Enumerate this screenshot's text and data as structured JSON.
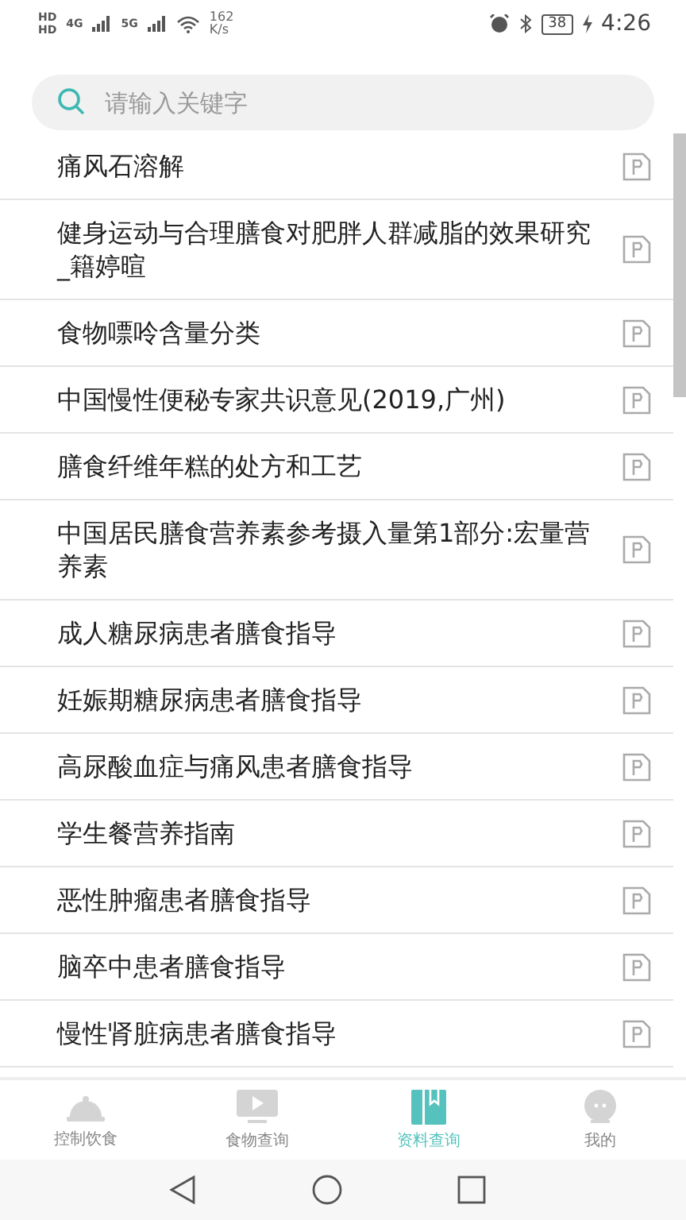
{
  "status_bar": {
    "sim_labels": [
      "HD",
      "HD"
    ],
    "networks": [
      "4G",
      "5G"
    ],
    "speed": [
      "162",
      "K/s"
    ],
    "battery": "38",
    "time": "4:26"
  },
  "search": {
    "placeholder": "请输入关键字"
  },
  "documents": [
    {
      "title": "痛风石溶解"
    },
    {
      "title": "健身运动与合理膳食对肥胖人群减脂的效果研究_籍婷暄"
    },
    {
      "title": "食物嘌呤含量分类"
    },
    {
      "title": "中国慢性便秘专家共识意见(2019,广州)"
    },
    {
      "title": "膳食纤维年糕的处方和工艺"
    },
    {
      "title": "中国居民膳食营养素参考摄入量第1部分:宏量营养素"
    },
    {
      "title": "成人糖尿病患者膳食指导"
    },
    {
      "title": "妊娠期糖尿病患者膳食指导"
    },
    {
      "title": "高尿酸血症与痛风患者膳食指导"
    },
    {
      "title": "学生餐营养指南"
    },
    {
      "title": "恶性肿瘤患者膳食指导"
    },
    {
      "title": "脑卒中患者膳食指导"
    },
    {
      "title": "慢性肾脏病患者膳食指导"
    }
  ],
  "bottom_nav": [
    {
      "label": "控制饮食",
      "kind": "cloche",
      "selected": false
    },
    {
      "label": "食物查询",
      "kind": "video",
      "selected": false
    },
    {
      "label": "资料查询",
      "kind": "book",
      "selected": true
    },
    {
      "label": "我的",
      "kind": "chat",
      "selected": false
    }
  ]
}
